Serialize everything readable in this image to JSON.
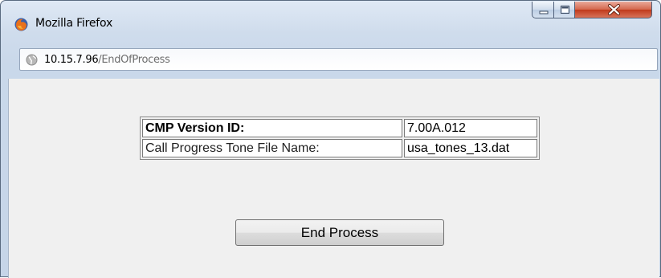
{
  "window": {
    "title": "Mozilla Firefox",
    "controls": [
      "minimize-icon",
      "maximize-icon",
      "close-icon"
    ]
  },
  "address_bar": {
    "host": "10.15.7.96",
    "path": "/EndOfProcess",
    "icon": "globe-icon"
  },
  "info_table": {
    "rows": [
      {
        "label": "CMP Version ID:",
        "value": "7.00A.012"
      },
      {
        "label": "Call Progress Tone File Name:",
        "value": "usa_tones_13.dat"
      }
    ]
  },
  "actions": {
    "end_process_label": "End Process"
  },
  "colors": {
    "close_button": "#c0391b",
    "content_background": "#f0f0f0",
    "window_frame": "#c9d8ea"
  }
}
